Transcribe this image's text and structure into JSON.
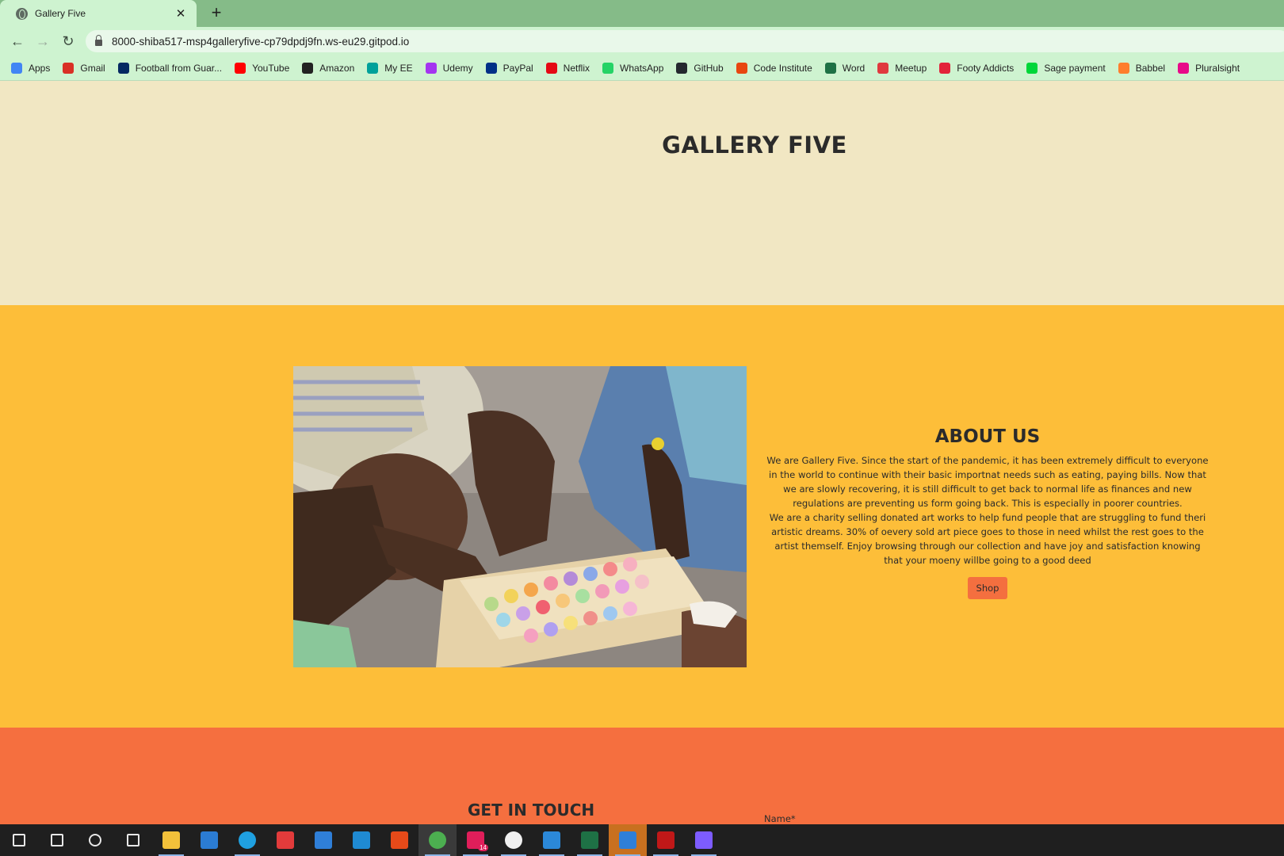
{
  "browser": {
    "tab_title": "Gallery Five",
    "tab_close": "✕",
    "new_tab": "+",
    "back": "←",
    "forward": "→",
    "reload": "↻",
    "url": "8000-shiba517-msp4galleryfive-cp79dpdj9fn.ws-eu29.gitpod.io",
    "bookmarks": [
      {
        "label": "Apps",
        "icon": "apps-grid-icon",
        "color": "#4285f4"
      },
      {
        "label": "Gmail",
        "icon": "gmail-icon",
        "color": "#d93025"
      },
      {
        "label": "Football from Guar...",
        "icon": "guardian-icon",
        "color": "#052962"
      },
      {
        "label": "YouTube",
        "icon": "youtube-icon",
        "color": "#ff0000"
      },
      {
        "label": "Amazon",
        "icon": "amazon-icon",
        "color": "#222222"
      },
      {
        "label": "My EE",
        "icon": "ee-icon",
        "color": "#00a19a"
      },
      {
        "label": "Udemy",
        "icon": "udemy-icon",
        "color": "#a435f0"
      },
      {
        "label": "PayPal",
        "icon": "paypal-icon",
        "color": "#003087"
      },
      {
        "label": "Netflix",
        "icon": "netflix-icon",
        "color": "#e50914"
      },
      {
        "label": "WhatsApp",
        "icon": "whatsapp-icon",
        "color": "#25d366"
      },
      {
        "label": "GitHub",
        "icon": "github-icon",
        "color": "#24292f"
      },
      {
        "label": "Code Institute",
        "icon": "code-institute-icon",
        "color": "#e84610"
      },
      {
        "label": "Word",
        "icon": "word-icon",
        "color": "#1e7145"
      },
      {
        "label": "Meetup",
        "icon": "meetup-icon",
        "color": "#e0393e"
      },
      {
        "label": "Footy Addicts",
        "icon": "footy-addicts-icon",
        "color": "#e2233a"
      },
      {
        "label": "Sage payment",
        "icon": "sage-icon",
        "color": "#00d639"
      },
      {
        "label": "Babbel",
        "icon": "babbel-icon",
        "color": "#ff7e2d"
      },
      {
        "label": "Pluralsight",
        "icon": "pluralsight-icon",
        "color": "#e80a89"
      }
    ]
  },
  "site": {
    "hero_title": "GALLERY FIVE",
    "about": {
      "heading": "ABOUT US",
      "para1": "We are Gallery Five. Since the start of the pandemic, it has been extremely difficult to everyone in the world to continue with their basic importnat needs such as eating, paying bills. Now that we are slowly recovering, it is still difficult to get back to normal life as finances and new regulations are preventing us form going back. This is especially in poorer countries.",
      "para2": "We are a charity selling donated art works to help fund people that are struggling to fund theri artistic dreams. 30% of oevery sold art piece goes to those in need whilst the rest goes to the artist themself. Enjoy browsing through our collection and have joy and satisfaction knowing that your moeny willbe going to a good deed",
      "shop_label": "Shop"
    },
    "contact": {
      "heading": "GET IN TOUCH",
      "name_label": "Name*"
    }
  },
  "taskbar": {
    "items": [
      {
        "icon": "windows-start-icon"
      },
      {
        "icon": "search-icon"
      },
      {
        "icon": "cortana-icon"
      },
      {
        "icon": "task-view-icon"
      },
      {
        "icon": "file-explorer-icon",
        "color": "#f3c13a"
      },
      {
        "icon": "microsoft-store-icon",
        "color": "#2b7cd3"
      },
      {
        "icon": "edge-icon",
        "color": "#1fa0e0"
      },
      {
        "icon": "gift-icon",
        "color": "#e23b3b"
      },
      {
        "icon": "mail-icon",
        "color": "#2f7fd8"
      },
      {
        "icon": "vscode-icon",
        "color": "#1f8ad2"
      },
      {
        "icon": "office-icon",
        "color": "#e64a19"
      },
      {
        "icon": "chrome-icon",
        "color": "#4caf50"
      },
      {
        "icon": "slack-icon",
        "color": "#e01e5a",
        "badge": "14"
      },
      {
        "icon": "smiley-app-icon",
        "color": "#f0f0f0"
      },
      {
        "icon": "photos-icon",
        "color": "#2b88d8"
      },
      {
        "icon": "excel-icon",
        "color": "#1e7145"
      },
      {
        "icon": "security-shield-icon",
        "color": "#2f7fd8"
      },
      {
        "icon": "mcafee-icon",
        "color": "#c01818"
      },
      {
        "icon": "paint-drop-icon",
        "color": "#7d5cff"
      }
    ]
  }
}
